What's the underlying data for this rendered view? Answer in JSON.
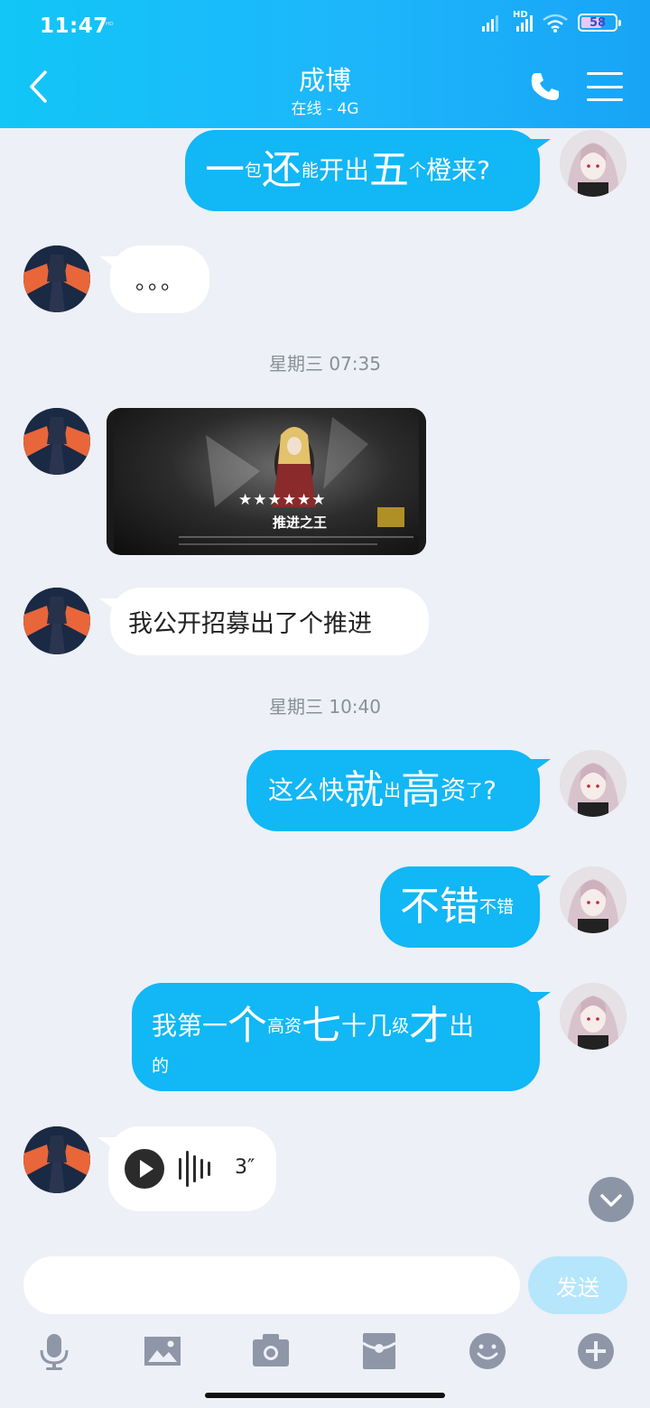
{
  "status_bar": {
    "time": "11:47",
    "small_label": "ᴴᴰ",
    "hd_label": "HD",
    "battery": "58"
  },
  "header": {
    "contact_name": "成博",
    "contact_status": "在线 - 4G",
    "icons": [
      "back-icon",
      "phone-icon",
      "menu-icon"
    ]
  },
  "messages": [
    {
      "from": "me",
      "segments": [
        {
          "text": "一",
          "size": "big"
        },
        {
          "text": "包",
          "size": "sm"
        },
        {
          "text": "还",
          "size": "big"
        },
        {
          "text": "能",
          "size": "sm"
        },
        {
          "text": "开出",
          "size": "md"
        },
        {
          "text": "五",
          "size": "big"
        },
        {
          "text": "个",
          "size": "sm"
        },
        {
          "text": "橙来?",
          "size": "md"
        }
      ]
    },
    {
      "from": "them",
      "text": "。。。"
    },
    {
      "type": "timestamp",
      "text": "星期三 07:35"
    },
    {
      "from": "them",
      "type": "image",
      "caption": "★★★★★★",
      "name_text": "推进之王"
    },
    {
      "from": "them",
      "text": "我公开招募出了个推进"
    },
    {
      "type": "timestamp",
      "text": "星期三 10:40"
    },
    {
      "from": "me",
      "segments": [
        {
          "text": "这么快",
          "size": "md"
        },
        {
          "text": "就",
          "size": "big"
        },
        {
          "text": "出",
          "size": "sm"
        },
        {
          "text": "高",
          "size": "big"
        },
        {
          "text": "资",
          "size": "md"
        },
        {
          "text": "了",
          "size": "sm"
        },
        {
          "text": "?",
          "size": "md"
        }
      ]
    },
    {
      "from": "me",
      "segments": [
        {
          "text": "不错",
          "size": "big"
        },
        {
          "text": "不错",
          "size": "sm"
        }
      ]
    },
    {
      "from": "me",
      "lines": [
        [
          {
            "text": "我第",
            "size": "md"
          },
          {
            "text": "一",
            "size": "md"
          },
          {
            "text": "个",
            "size": "big"
          },
          {
            "text": "高资",
            "size": "sm"
          },
          {
            "text": "七",
            "size": "big"
          },
          {
            "text": "十",
            "size": "md"
          },
          {
            "text": "几",
            "size": "md"
          },
          {
            "text": "级",
            "size": "sm"
          },
          {
            "text": "才",
            "size": "big"
          },
          {
            "text": "出",
            "size": "md"
          }
        ],
        [
          {
            "text": "的",
            "size": "sm"
          }
        ]
      ]
    },
    {
      "from": "them",
      "type": "voice",
      "duration": "3″"
    }
  ],
  "input": {
    "placeholder": "",
    "send_label": "发送"
  },
  "toolbar": {
    "icons": [
      "microphone-icon",
      "image-icon",
      "camera-icon",
      "red-packet-icon",
      "emoji-icon",
      "plus-icon"
    ]
  },
  "colors": {
    "header_blue": "#12b7f5",
    "bubble_me": "#12b7f5",
    "bubble_them": "#ffffff",
    "background": "#edf0f6"
  }
}
